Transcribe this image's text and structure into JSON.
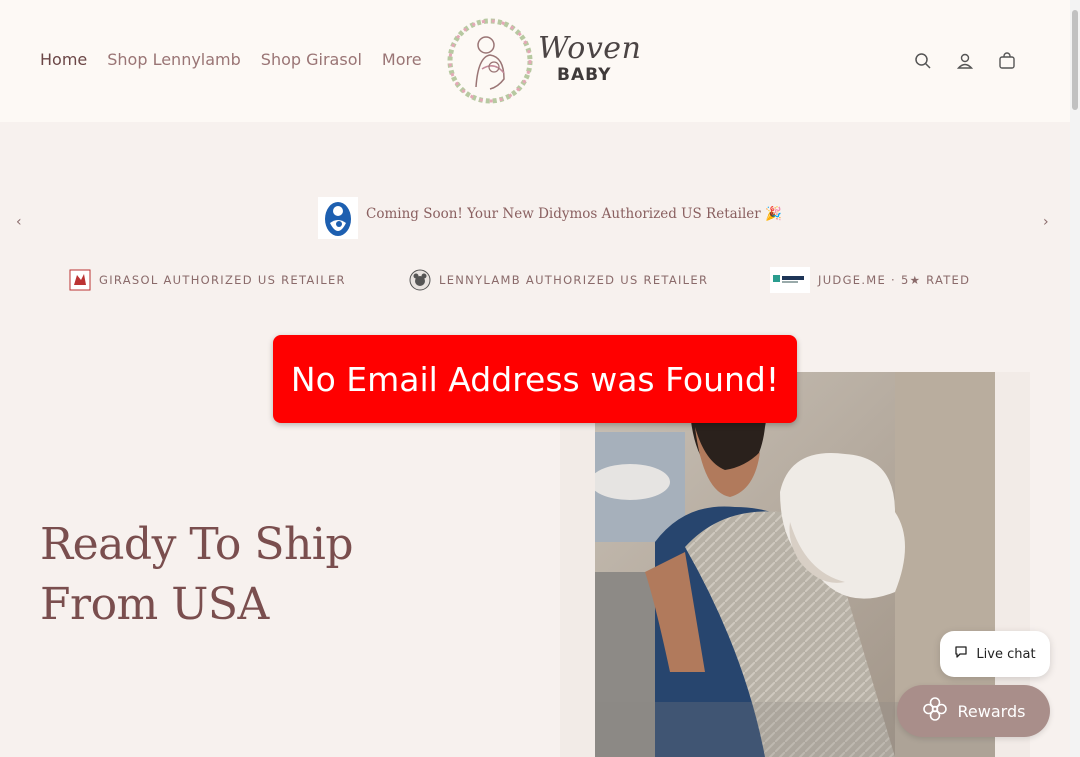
{
  "nav": {
    "items": [
      "Home",
      "Shop Lennylamb",
      "Shop Girasol",
      "More"
    ]
  },
  "logo": {
    "script_text": "Woven",
    "sub_text": "BABY"
  },
  "header_icons": [
    "search-icon",
    "account-icon",
    "cart-icon"
  ],
  "announcement": {
    "text": "Coming Soon! Your New Didymos Authorized US Retailer 🎉",
    "prev": "‹",
    "next": "›"
  },
  "badges": [
    {
      "icon": "girasol-logo-icon",
      "text": "GIRASOL AUTHORIZED US RETAILER"
    },
    {
      "icon": "lennylamb-logo-icon",
      "text": "LENNYLAMB AUTHORIZED US RETAILER"
    },
    {
      "icon": "judgeme-logo-icon",
      "text": "JUDGE.ME · 5★ RATED"
    }
  ],
  "hero": {
    "title_line1": "Ready To Ship",
    "title_line2": "From USA"
  },
  "toast": {
    "message": "No Email Address was Found!"
  },
  "livechat": {
    "label": "Live chat"
  },
  "rewards": {
    "label": "Rewards"
  },
  "colors": {
    "toast_bg": "#ff0000",
    "accent": "#7a4e4e",
    "header_bg": "#fdf9f5",
    "page_bg": "#f7f1ee",
    "rewards_bg": "#a98e8a"
  }
}
